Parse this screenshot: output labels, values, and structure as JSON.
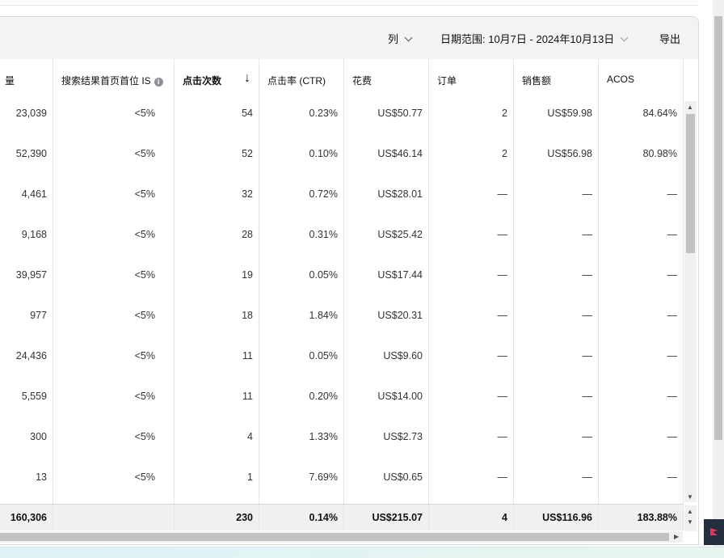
{
  "toolbar": {
    "columns_label": "列",
    "date_range_label": "日期范围: 10月7日 - 2024年10月13日",
    "export_label": "导出"
  },
  "columns": [
    {
      "label": "量"
    },
    {
      "label": "搜索结果首页首位 IS"
    },
    {
      "label": "点击次数"
    },
    {
      "label": "点击率 (CTR)"
    },
    {
      "label": "花费"
    },
    {
      "label": "订单"
    },
    {
      "label": "销售额"
    },
    {
      "label": "ACOS"
    }
  ],
  "rows": [
    [
      "23,039",
      "<5%",
      "54",
      "0.23%",
      "US$50.77",
      "2",
      "US$59.98",
      "84.64%"
    ],
    [
      "52,390",
      "<5%",
      "52",
      "0.10%",
      "US$46.14",
      "2",
      "US$56.98",
      "80.98%"
    ],
    [
      "4,461",
      "<5%",
      "32",
      "0.72%",
      "US$28.01",
      "—",
      "—",
      "—"
    ],
    [
      "9,168",
      "<5%",
      "28",
      "0.31%",
      "US$25.42",
      "—",
      "—",
      "—"
    ],
    [
      "39,957",
      "<5%",
      "19",
      "0.05%",
      "US$17.44",
      "—",
      "—",
      "—"
    ],
    [
      "977",
      "<5%",
      "18",
      "1.84%",
      "US$20.31",
      "—",
      "—",
      "—"
    ],
    [
      "24,436",
      "<5%",
      "11",
      "0.05%",
      "US$9.60",
      "—",
      "—",
      "—"
    ],
    [
      "5,559",
      "<5%",
      "11",
      "0.20%",
      "US$14.00",
      "—",
      "—",
      "—"
    ],
    [
      "300",
      "<5%",
      "4",
      "1.33%",
      "US$2.73",
      "—",
      "—",
      "—"
    ],
    [
      "13",
      "<5%",
      "1",
      "7.69%",
      "US$0.65",
      "—",
      "—",
      "—"
    ]
  ],
  "totals": [
    "160,306",
    "",
    "230",
    "0.14%",
    "US$215.07",
    "4",
    "US$116.96",
    "183.88%"
  ],
  "colors": {
    "toolbar_bg": "#f3f3f3",
    "border": "#e3e6e6",
    "total_bg": "#f0f0f0",
    "flag_accent": "#e8335d"
  }
}
